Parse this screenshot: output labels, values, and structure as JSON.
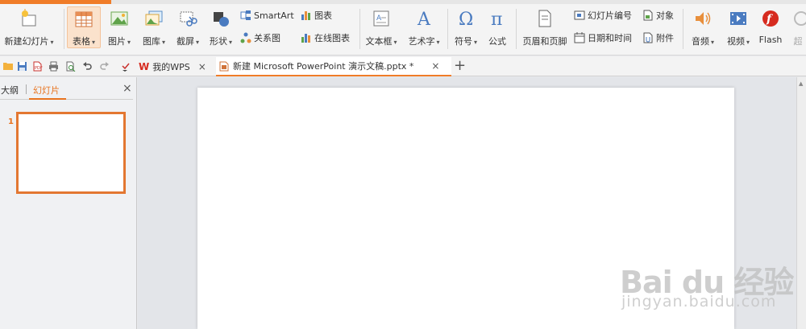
{
  "ribbon": {
    "new_slide": "新建幻灯片",
    "table": "表格",
    "picture": "图片",
    "gallery": "图库",
    "screenshot": "截屏",
    "shapes": "形状",
    "smartart": "SmartArt",
    "chart": "图表",
    "relation": "关系图",
    "online_chart": "在线图表",
    "textbox": "文本框",
    "wordart": "艺术字",
    "symbol": "符号",
    "formula": "公式",
    "header_footer": "页眉和页脚",
    "slide_number": "幻灯片编号",
    "date_time": "日期和时间",
    "object": "对象",
    "attachment": "附件",
    "audio": "音频",
    "video": "视频",
    "flash": "Flash",
    "hyperlink_partial": "超",
    "dropdown_arrow": "▾"
  },
  "tabs": {
    "home_label": "我的WPS",
    "doc_label": "新建 Microsoft PowerPoint 演示文稿.pptx *",
    "close_glyph": "×",
    "add_glyph": "+"
  },
  "left_pane": {
    "outline_tab": "大纲",
    "slides_tab": "幻灯片",
    "close_glyph": "×",
    "slide_number": "1"
  },
  "watermark": {
    "brand": "Bai du 经验",
    "url": "jingyan.baidu.com"
  },
  "colors": {
    "accent": "#f07c28",
    "thumb_border": "#e37731"
  }
}
